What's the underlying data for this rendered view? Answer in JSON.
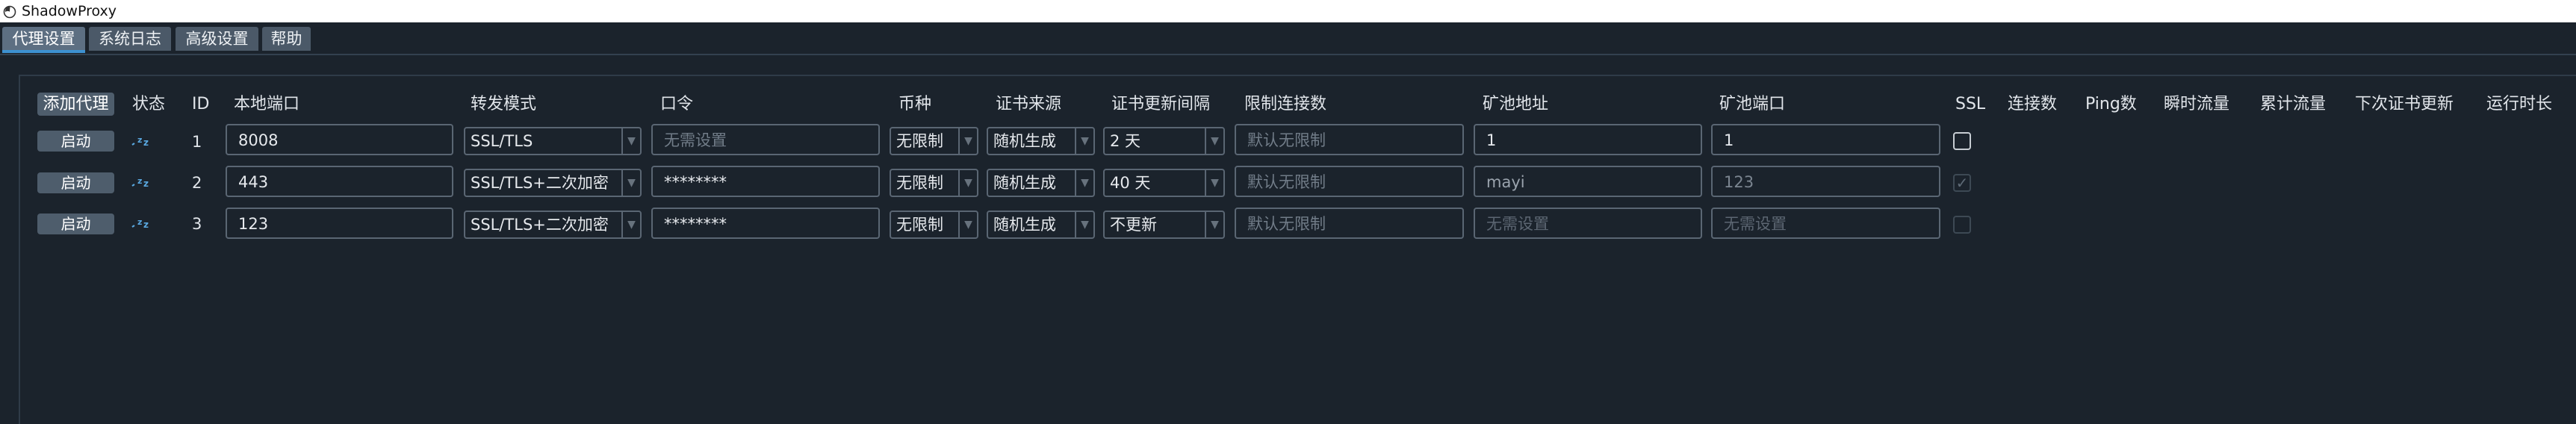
{
  "window": {
    "title": "ShadowProxy"
  },
  "tabs": [
    {
      "label": "代理设置",
      "active": true
    },
    {
      "label": "系统日志",
      "active": false
    },
    {
      "label": "高级设置",
      "active": false
    },
    {
      "label": "帮助",
      "active": false
    }
  ],
  "table": {
    "add_button_label": "添加代理",
    "headers": {
      "status": "状态",
      "id": "ID",
      "local_port": "本地端口",
      "forward_mode": "转发模式",
      "password": "口令",
      "coin": "币种",
      "cert_source": "证书来源",
      "cert_interval": "证书更新间隔",
      "conn_limit": "限制连接数",
      "pool_address": "矿池地址",
      "pool_port": "矿池端口",
      "ssl": "SSL",
      "connections": "连接数",
      "ping": "Ping数",
      "instant_traffic": "瞬时流量",
      "total_traffic": "累计流量",
      "next_cert_update": "下次证书更新",
      "uptime": "运行时长"
    },
    "rows": [
      {
        "start_label": "启动",
        "status_icon": "idle-zz-icon",
        "id": "1",
        "local_port": "8008",
        "forward_mode": "SSL/TLS",
        "password": "",
        "password_placeholder": "无需设置",
        "coin": "无限制",
        "cert_source": "随机生成",
        "cert_interval": "2 天",
        "conn_limit": "",
        "conn_limit_placeholder": "默认无限制",
        "pool_address": "1",
        "pool_address_placeholder": "",
        "pool_port": "1",
        "pool_port_placeholder": "",
        "ssl_checked": false,
        "ssl_enabled": true
      },
      {
        "start_label": "启动",
        "status_icon": "idle-zz-icon",
        "id": "2",
        "local_port": "443",
        "forward_mode": "SSL/TLS+二次加密",
        "password": "********",
        "password_placeholder": "",
        "coin": "无限制",
        "cert_source": "随机生成",
        "cert_interval": "40 天",
        "conn_limit": "",
        "conn_limit_placeholder": "默认无限制",
        "pool_address": "mayi",
        "pool_address_placeholder": "",
        "pool_port": "123",
        "pool_port_placeholder": "",
        "ssl_checked": true,
        "ssl_enabled": false
      },
      {
        "start_label": "启动",
        "status_icon": "idle-zz-icon",
        "id": "3",
        "local_port": "123",
        "forward_mode": "SSL/TLS+二次加密",
        "password": "********",
        "password_placeholder": "",
        "coin": "无限制",
        "cert_source": "随机生成",
        "cert_interval": "不更新",
        "conn_limit": "",
        "conn_limit_placeholder": "默认无限制",
        "pool_address": "",
        "pool_address_placeholder": "无需设置",
        "pool_port": "",
        "pool_port_placeholder": "无需设置",
        "ssl_checked": false,
        "ssl_enabled": false
      }
    ]
  },
  "colors": {
    "background": "#1b232c",
    "tab_active_underline": "#3d91d1",
    "button": "#4e5d6c",
    "field_border": "#5a6673"
  }
}
